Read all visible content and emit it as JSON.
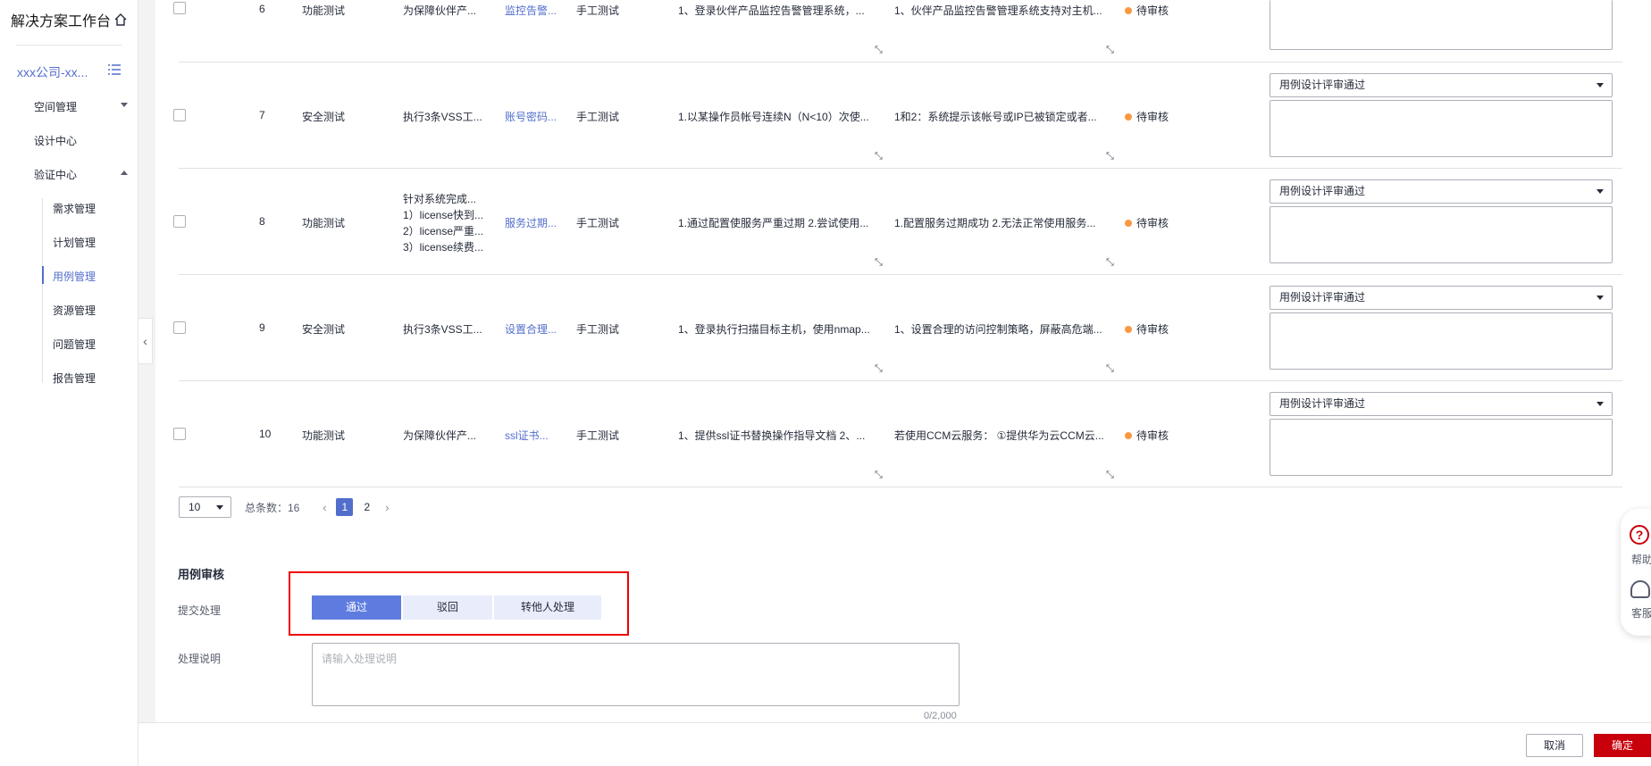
{
  "sidebar": {
    "brand": "解决方案工作台",
    "project": "xxx公司-xx...",
    "nav": [
      {
        "label": "空间管理"
      },
      {
        "label": "设计中心"
      },
      {
        "label": "验证中心"
      }
    ],
    "subnav": [
      {
        "label": "需求管理"
      },
      {
        "label": "计划管理"
      },
      {
        "label": "用例管理"
      },
      {
        "label": "资源管理"
      },
      {
        "label": "问题管理"
      },
      {
        "label": "报告管理"
      }
    ]
  },
  "rows": [
    {
      "num": "6",
      "type": "功能测试",
      "desc": "为保障伙伴产...",
      "link": "监控告警...",
      "method": "手工测试",
      "steps": "1、登录伙伴产品监控告警管理系统，...",
      "expected": "1、伙伴产品监控告警管理系统支持对主机...",
      "status": "待审核"
    },
    {
      "num": "7",
      "type": "安全测试",
      "desc": "执行3条VSS工...",
      "link": "账号密码...",
      "method": "手工测试",
      "steps": "1.以某操作员帐号连续N（N<10）次使...",
      "expected": "1和2：系统提示该帐号或IP已被锁定或者...",
      "status": "待审核",
      "review": "用例设计评审通过"
    },
    {
      "num": "8",
      "type": "功能测试",
      "desc_lines": [
        "针对系统完成...",
        "1）license快到...",
        "2）license严重...",
        "3）license续费..."
      ],
      "link": "服务过期...",
      "method": "手工测试",
      "steps": "1.通过配置使服务严重过期 2.尝试使用...",
      "expected": "1.配置服务过期成功 2.无法正常使用服务...",
      "status": "待审核",
      "review": "用例设计评审通过"
    },
    {
      "num": "9",
      "type": "安全测试",
      "desc": "执行3条VSS工...",
      "link": "设置合理...",
      "method": "手工测试",
      "steps": "1、登录执行扫描目标主机，使用nmap...",
      "expected": "1、设置合理的访问控制策略，屏蔽高危端...",
      "status": "待审核",
      "review": "用例设计评审通过"
    },
    {
      "num": "10",
      "type": "功能测试",
      "desc": "为保障伙伴产...",
      "link": "ssl证书...",
      "method": "手工测试",
      "steps": "1、提供ssl证书替换操作指导文档 2、...",
      "expected": "若使用CCM云服务： ①提供华为云CCM云...",
      "status": "待审核",
      "review": "用例设计评审通过"
    }
  ],
  "pager": {
    "size": "10",
    "total": "总条数：16",
    "pages": [
      "1",
      "2"
    ],
    "prev": "‹",
    "next": "›"
  },
  "review": {
    "title": "用例审核",
    "submit_label": "提交处理",
    "options": [
      "通过",
      "驳回",
      "转他人处理"
    ],
    "note_label": "处理说明",
    "note_placeholder": "请输入处理说明",
    "note_count": "0/2,000"
  },
  "footer": {
    "cancel": "取消",
    "confirm": "确定"
  },
  "float": {
    "help": "帮助",
    "service": "客服"
  },
  "colors": {
    "accent": "#526ecc",
    "primary_btn": "#5e7ce0",
    "danger": "#c7000b",
    "status_pending": "#fa9841"
  }
}
